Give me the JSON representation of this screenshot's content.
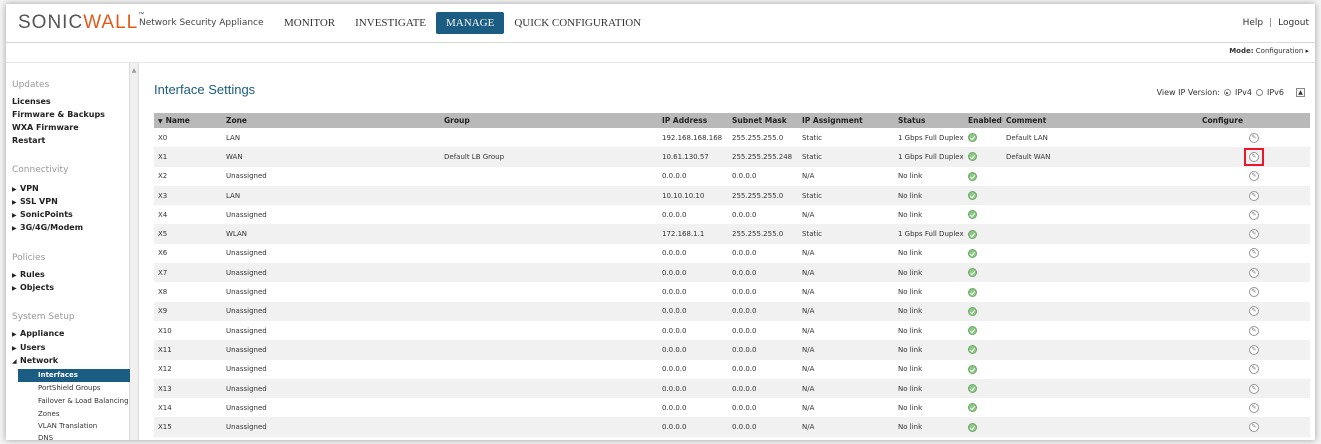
{
  "header": {
    "logo_left": "SONIC",
    "logo_right": "WALL",
    "logo_tm": "™",
    "product": "Network Security Appliance",
    "nav": [
      "MONITOR",
      "INVESTIGATE",
      "MANAGE",
      "QUICK CONFIGURATION"
    ],
    "active_nav": "MANAGE",
    "help": "Help",
    "separator": "|",
    "logout": "Logout"
  },
  "mode": {
    "label": "Mode:",
    "value": "Configuration ▸"
  },
  "sidebar": {
    "updates_title": "Updates",
    "updates": [
      "Licenses",
      "Firmware & Backups",
      "WXA Firmware",
      "Restart"
    ],
    "connectivity_title": "Connectivity",
    "connectivity": [
      "VPN",
      "SSL VPN",
      "SonicPoints",
      "3G/4G/Modem"
    ],
    "policies_title": "Policies",
    "policies": [
      "Rules",
      "Objects"
    ],
    "system_title": "System Setup",
    "system": [
      "Appliance",
      "Users",
      "Network"
    ],
    "network_sub": [
      "Interfaces",
      "PortShield Groups",
      "Failover & Load Balancing",
      "Zones",
      "VLAN Translation",
      "DNS"
    ]
  },
  "main": {
    "title": "Interface Settings",
    "ip_version_label": "View IP Version:",
    "ipv4": "IPv4",
    "ipv6": "IPv6"
  },
  "table": {
    "columns": [
      "Name",
      "Zone",
      "Group",
      "IP Address",
      "Subnet Mask",
      "IP Assignment",
      "Status",
      "Enabled",
      "Comment",
      "Configure"
    ],
    "rows": [
      [
        "X0",
        "LAN",
        "",
        "192.168.168.168",
        "255.255.255.0",
        "Static",
        "1 Gbps Full Duplex",
        "",
        "Default LAN",
        ""
      ],
      [
        "X1",
        "WAN",
        "Default LB Group",
        "10.61.130.57",
        "255.255.255.248",
        "Static",
        "1 Gbps Full Duplex",
        "",
        "Default WAN",
        ""
      ],
      [
        "X2",
        "Unassigned",
        "",
        "0.0.0.0",
        "0.0.0.0",
        "N/A",
        "No link",
        "",
        "",
        ""
      ],
      [
        "X3",
        "LAN",
        "",
        "10.10.10.10",
        "255.255.255.0",
        "Static",
        "No link",
        "",
        "",
        ""
      ],
      [
        "X4",
        "Unassigned",
        "",
        "0.0.0.0",
        "0.0.0.0",
        "N/A",
        "No link",
        "",
        "",
        ""
      ],
      [
        "X5",
        "WLAN",
        "",
        "172.168.1.1",
        "255.255.255.0",
        "Static",
        "1 Gbps Full Duplex",
        "",
        "",
        ""
      ],
      [
        "X6",
        "Unassigned",
        "",
        "0.0.0.0",
        "0.0.0.0",
        "N/A",
        "No link",
        "",
        "",
        ""
      ],
      [
        "X7",
        "Unassigned",
        "",
        "0.0.0.0",
        "0.0.0.0",
        "N/A",
        "No link",
        "",
        "",
        ""
      ],
      [
        "X8",
        "Unassigned",
        "",
        "0.0.0.0",
        "0.0.0.0",
        "N/A",
        "No link",
        "",
        "",
        ""
      ],
      [
        "X9",
        "Unassigned",
        "",
        "0.0.0.0",
        "0.0.0.0",
        "N/A",
        "No link",
        "",
        "",
        ""
      ],
      [
        "X10",
        "Unassigned",
        "",
        "0.0.0.0",
        "0.0.0.0",
        "N/A",
        "No link",
        "",
        "",
        ""
      ],
      [
        "X11",
        "Unassigned",
        "",
        "0.0.0.0",
        "0.0.0.0",
        "N/A",
        "No link",
        "",
        "",
        ""
      ],
      [
        "X12",
        "Unassigned",
        "",
        "0.0.0.0",
        "0.0.0.0",
        "N/A",
        "No link",
        "",
        "",
        ""
      ],
      [
        "X13",
        "Unassigned",
        "",
        "0.0.0.0",
        "0.0.0.0",
        "N/A",
        "No link",
        "",
        "",
        ""
      ],
      [
        "X14",
        "Unassigned",
        "",
        "0.0.0.0",
        "0.0.0.0",
        "N/A",
        "No link",
        "",
        "",
        ""
      ],
      [
        "X15",
        "Unassigned",
        "",
        "0.0.0.0",
        "0.0.0.0",
        "N/A",
        "No link",
        "",
        "",
        ""
      ]
    ],
    "highlighted_configure_row": "X1",
    "highlight_color": "#e8192c"
  },
  "colors": {
    "accent": "#1b5c82",
    "brand_orange": "#e25b1c",
    "header_gray": "#b9b9b9",
    "status_ok": "#8bc985"
  },
  "icons": {
    "enabled": "check-circle-icon",
    "configure": "pencil-icon"
  }
}
